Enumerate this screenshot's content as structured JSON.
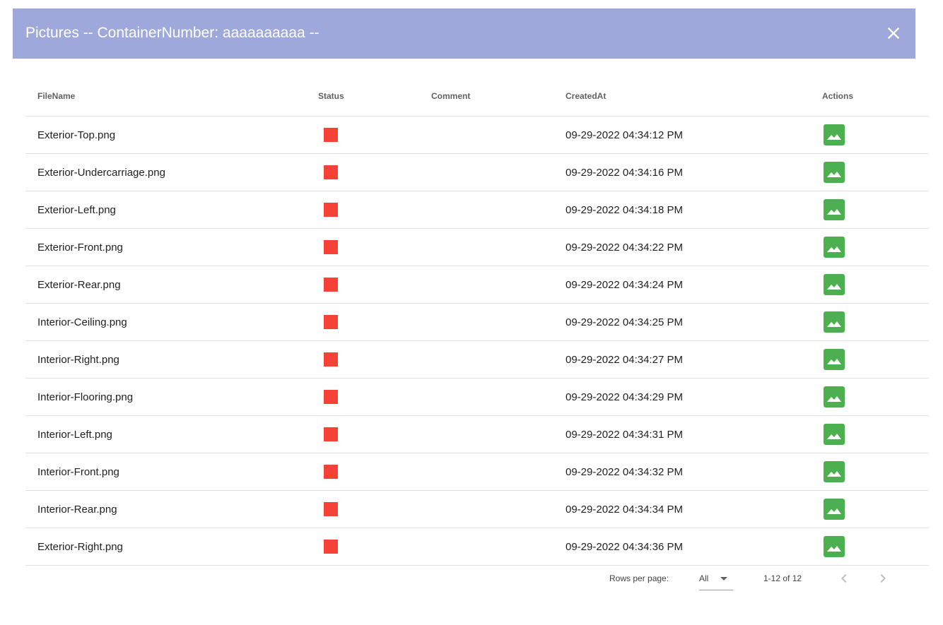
{
  "dialog": {
    "title": "Pictures -- ContainerNumber: aaaaaaaaaa --",
    "close_icon": "close-icon"
  },
  "table": {
    "headers": {
      "file_name": "FileName",
      "status": "Status",
      "comment": "Comment",
      "created_at": "CreatedAt",
      "actions": "Actions"
    },
    "rows": [
      {
        "file_name": "Exterior-Top.png",
        "status_color": "#f44336",
        "comment": "",
        "created_at": "09-29-2022 04:34:12 PM"
      },
      {
        "file_name": "Exterior-Undercarriage.png",
        "status_color": "#f44336",
        "comment": "",
        "created_at": "09-29-2022 04:34:16 PM"
      },
      {
        "file_name": "Exterior-Left.png",
        "status_color": "#f44336",
        "comment": "",
        "created_at": "09-29-2022 04:34:18 PM"
      },
      {
        "file_name": "Exterior-Front.png",
        "status_color": "#f44336",
        "comment": "",
        "created_at": "09-29-2022 04:34:22 PM"
      },
      {
        "file_name": "Exterior-Rear.png",
        "status_color": "#f44336",
        "comment": "",
        "created_at": "09-29-2022 04:34:24 PM"
      },
      {
        "file_name": "Interior-Ceiling.png",
        "status_color": "#f44336",
        "comment": "",
        "created_at": "09-29-2022 04:34:25 PM"
      },
      {
        "file_name": "Interior-Right.png",
        "status_color": "#f44336",
        "comment": "",
        "created_at": "09-29-2022 04:34:27 PM"
      },
      {
        "file_name": "Interior-Flooring.png",
        "status_color": "#f44336",
        "comment": "",
        "created_at": "09-29-2022 04:34:29 PM"
      },
      {
        "file_name": "Interior-Left.png",
        "status_color": "#f44336",
        "comment": "",
        "created_at": "09-29-2022 04:34:31 PM"
      },
      {
        "file_name": "Interior-Front.png",
        "status_color": "#f44336",
        "comment": "",
        "created_at": "09-29-2022 04:34:32 PM"
      },
      {
        "file_name": "Interior-Rear.png",
        "status_color": "#f44336",
        "comment": "",
        "created_at": "09-29-2022 04:34:34 PM"
      },
      {
        "file_name": "Exterior-Right.png",
        "status_color": "#f44336",
        "comment": "",
        "created_at": "09-29-2022 04:34:36 PM"
      }
    ],
    "action_icon": "image-icon",
    "action_color": "#4caf50"
  },
  "pagination": {
    "rows_per_page_label": "Rows per page:",
    "rows_per_page_value": "All",
    "page_info": "1-12 of 12",
    "prev_icon": "chevron-left-icon",
    "next_icon": "chevron-right-icon"
  },
  "colors": {
    "header_bg": "#9fa8da",
    "status_red": "#f44336",
    "action_green": "#4caf50"
  }
}
